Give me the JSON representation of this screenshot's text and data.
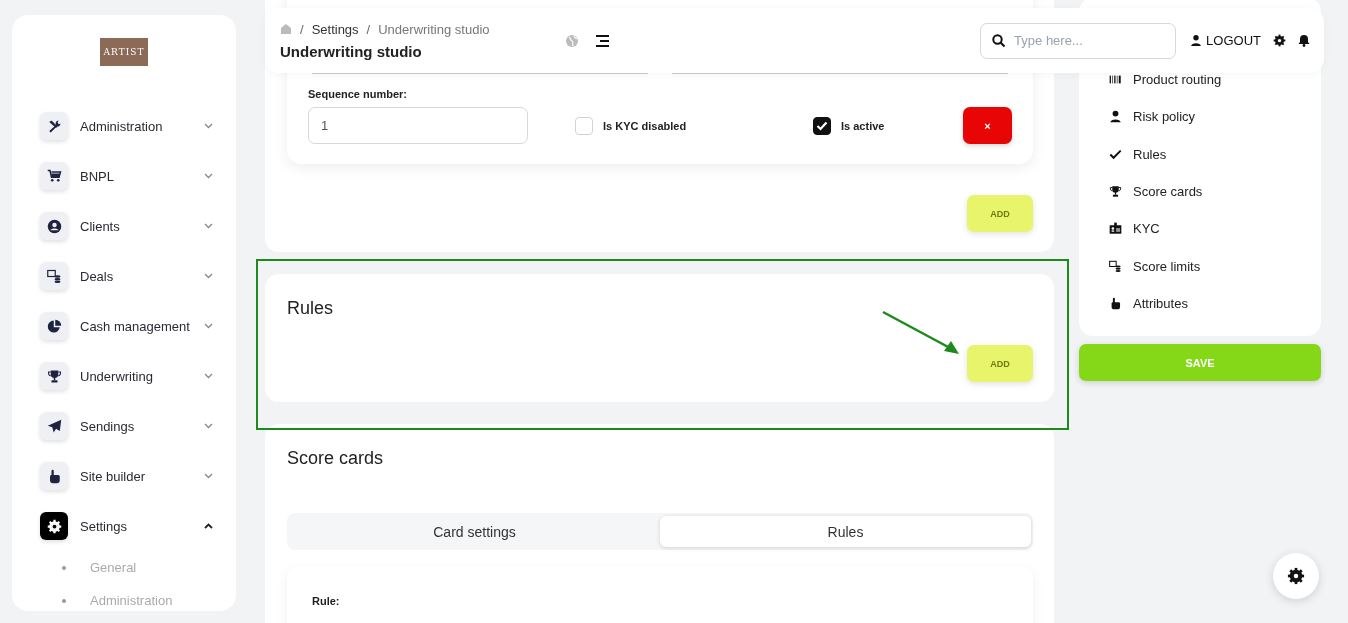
{
  "logo": {
    "text": "ARTIST"
  },
  "sidebar": {
    "items": [
      {
        "label": "Administration",
        "selected": false,
        "expanded": false
      },
      {
        "label": "BNPL",
        "selected": false,
        "expanded": false
      },
      {
        "label": "Clients",
        "selected": false,
        "expanded": false
      },
      {
        "label": "Deals",
        "selected": false,
        "expanded": false
      },
      {
        "label": "Cash management",
        "selected": false,
        "expanded": false
      },
      {
        "label": "Underwriting",
        "selected": false,
        "expanded": false
      },
      {
        "label": "Sendings",
        "selected": false,
        "expanded": false
      },
      {
        "label": "Site builder",
        "selected": false,
        "expanded": false
      },
      {
        "label": "Settings",
        "selected": true,
        "expanded": true,
        "children": [
          {
            "label": "General"
          },
          {
            "label": "Administration"
          }
        ]
      }
    ]
  },
  "header": {
    "breadcrumb": [
      {
        "separator": "/",
        "label": "Settings"
      },
      {
        "separator": "/",
        "label": "Underwriting studio"
      }
    ],
    "title": "Underwriting studio",
    "search": {
      "placeholder": "Type here..."
    },
    "logout": "LOGOUT"
  },
  "stage_card": {
    "sequence_label": "Sequence number:",
    "sequence_value": "1",
    "checkboxes": [
      {
        "label": "Is KYC disabled",
        "checked": false
      },
      {
        "label": "Is active",
        "checked": true
      }
    ],
    "delete_button": "×",
    "add_button": "ADD"
  },
  "rules_card": {
    "title": "Rules",
    "add_button": "ADD"
  },
  "score_cards": {
    "title": "Score cards",
    "tabs": [
      {
        "label": "Card settings",
        "selected": false
      },
      {
        "label": "Rules",
        "selected": true
      }
    ],
    "rule_label": "Rule:"
  },
  "right_nav": {
    "items": [
      {
        "label": "Product routing"
      },
      {
        "label": "Risk policy"
      },
      {
        "label": "Rules"
      },
      {
        "label": "Score cards"
      },
      {
        "label": "KYC"
      },
      {
        "label": "Score limits"
      },
      {
        "label": "Attributes"
      }
    ]
  },
  "save_button": "SAVE"
}
